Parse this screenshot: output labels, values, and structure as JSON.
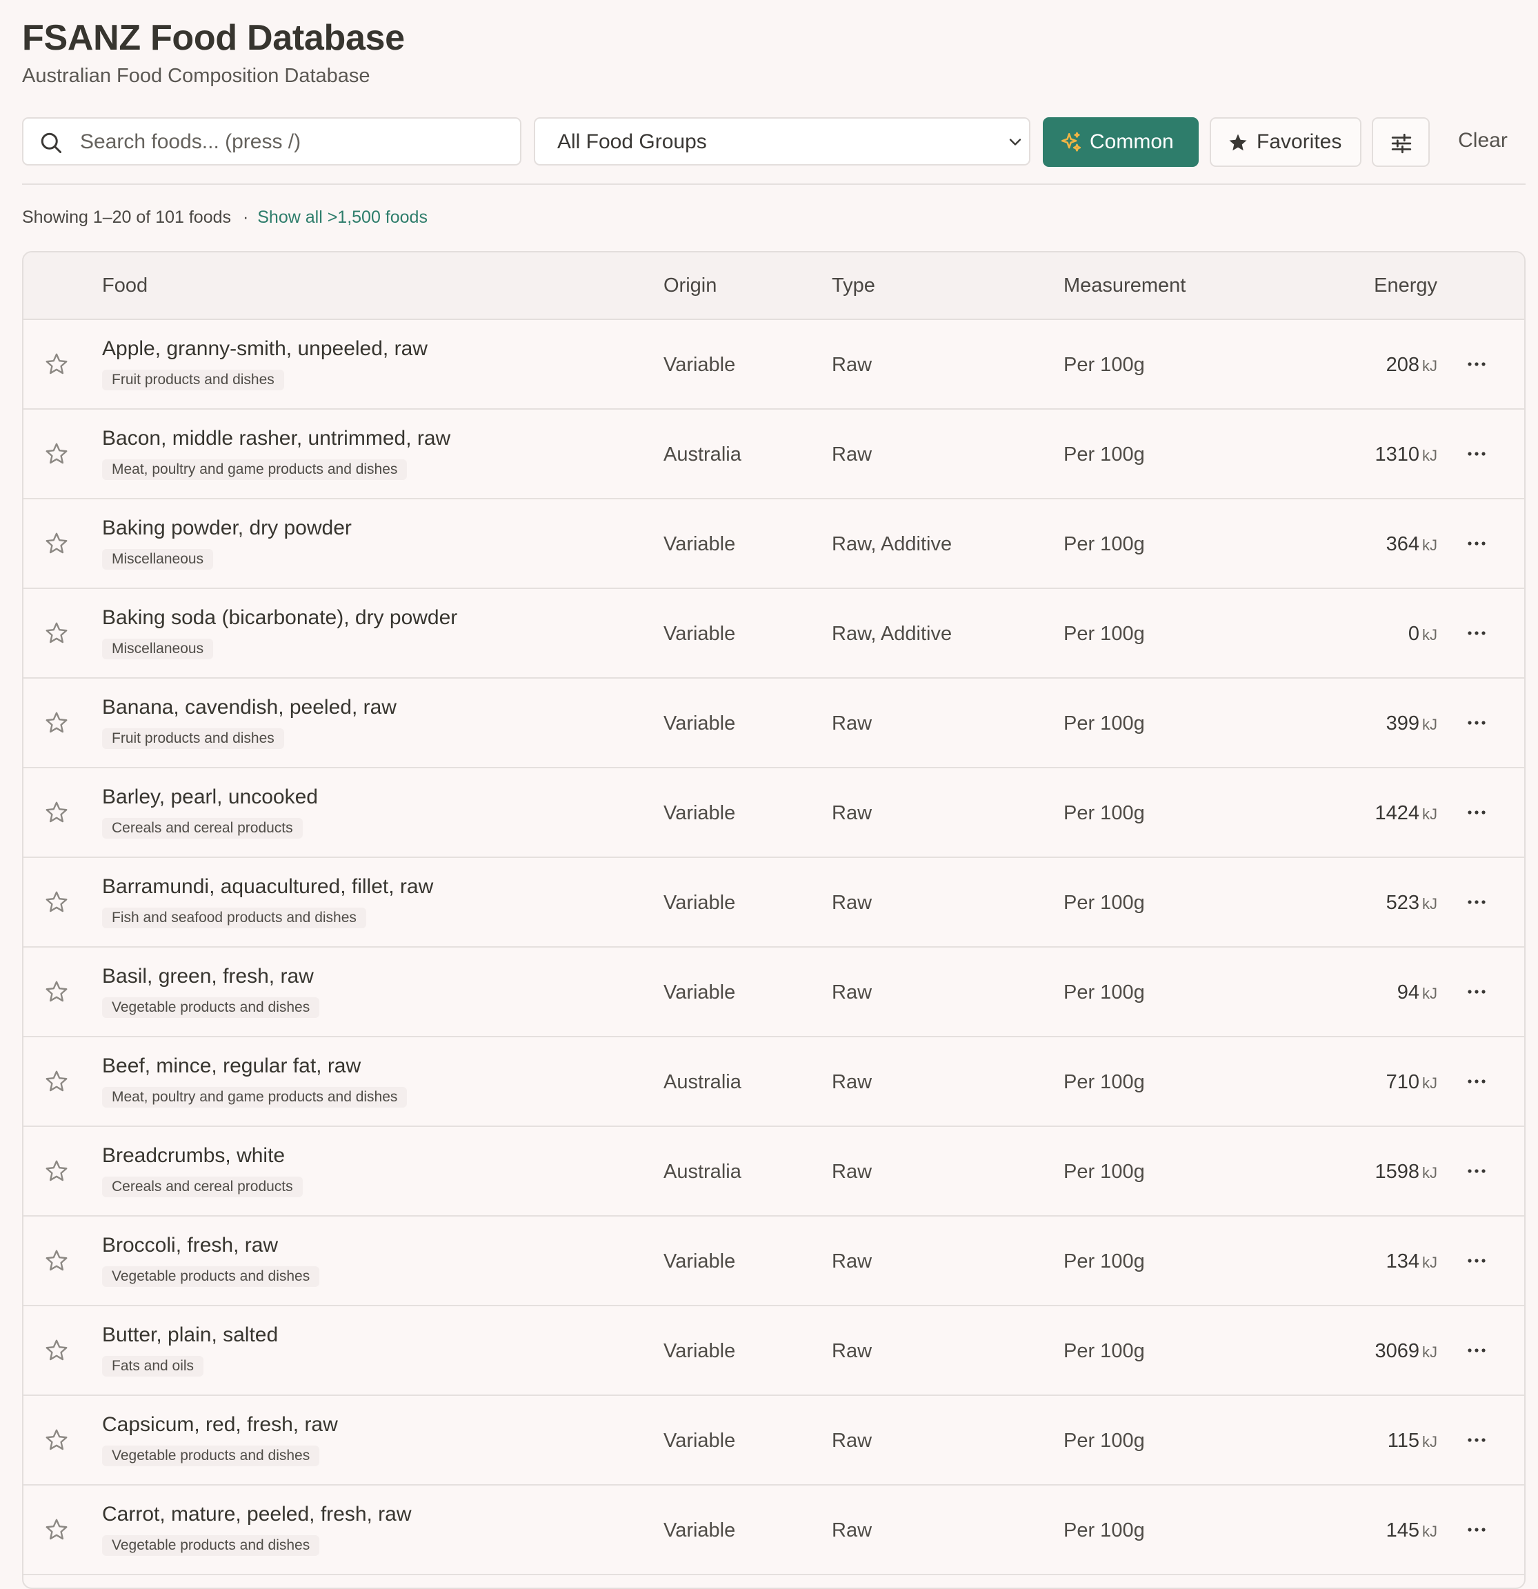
{
  "app": {
    "title": "FSANZ Food Database",
    "subtitle": "Australian Food Composition Database"
  },
  "toolbar": {
    "search_placeholder": "Search foods... (press /)",
    "search_value": "",
    "food_group_selected": "All Food Groups",
    "common_label": "Common",
    "favorites_label": "Favorites",
    "filter_icon": "sliders-icon",
    "clear_label": "Clear"
  },
  "summary": {
    "showing": "Showing 1–20 of 101 foods",
    "separator": "·",
    "show_all_link": "Show all >1,500 foods"
  },
  "colors": {
    "accent": "#2e7d6b",
    "background": "#fbf6f5",
    "sparkle": "#f2b544"
  },
  "table": {
    "headers": {
      "food": "Food",
      "origin": "Origin",
      "type": "Type",
      "measurement": "Measurement",
      "energy": "Energy"
    },
    "energy_unit": "kJ",
    "rows": [
      {
        "name": "Apple, granny-smith, unpeeled, raw",
        "group": "Fruit products and dishes",
        "origin": "Variable",
        "type": "Raw",
        "measurement": "Per 100g",
        "energy": "208"
      },
      {
        "name": "Bacon, middle rasher, untrimmed, raw",
        "group": "Meat, poultry and game products and dishes",
        "origin": "Australia",
        "type": "Raw",
        "measurement": "Per 100g",
        "energy": "1310"
      },
      {
        "name": "Baking powder, dry powder",
        "group": "Miscellaneous",
        "origin": "Variable",
        "type": "Raw, Additive",
        "measurement": "Per 100g",
        "energy": "364"
      },
      {
        "name": "Baking soda (bicarbonate), dry powder",
        "group": "Miscellaneous",
        "origin": "Variable",
        "type": "Raw, Additive",
        "measurement": "Per 100g",
        "energy": "0"
      },
      {
        "name": "Banana, cavendish, peeled, raw",
        "group": "Fruit products and dishes",
        "origin": "Variable",
        "type": "Raw",
        "measurement": "Per 100g",
        "energy": "399"
      },
      {
        "name": "Barley, pearl, uncooked",
        "group": "Cereals and cereal products",
        "origin": "Variable",
        "type": "Raw",
        "measurement": "Per 100g",
        "energy": "1424"
      },
      {
        "name": "Barramundi, aquacultured, fillet, raw",
        "group": "Fish and seafood products and dishes",
        "origin": "Variable",
        "type": "Raw",
        "measurement": "Per 100g",
        "energy": "523"
      },
      {
        "name": "Basil, green, fresh, raw",
        "group": "Vegetable products and dishes",
        "origin": "Variable",
        "type": "Raw",
        "measurement": "Per 100g",
        "energy": "94"
      },
      {
        "name": "Beef, mince, regular fat, raw",
        "group": "Meat, poultry and game products and dishes",
        "origin": "Australia",
        "type": "Raw",
        "measurement": "Per 100g",
        "energy": "710"
      },
      {
        "name": "Breadcrumbs, white",
        "group": "Cereals and cereal products",
        "origin": "Australia",
        "type": "Raw",
        "measurement": "Per 100g",
        "energy": "1598"
      },
      {
        "name": "Broccoli, fresh, raw",
        "group": "Vegetable products and dishes",
        "origin": "Variable",
        "type": "Raw",
        "measurement": "Per 100g",
        "energy": "134"
      },
      {
        "name": "Butter, plain, salted",
        "group": "Fats and oils",
        "origin": "Variable",
        "type": "Raw",
        "measurement": "Per 100g",
        "energy": "3069"
      },
      {
        "name": "Capsicum, red, fresh, raw",
        "group": "Vegetable products and dishes",
        "origin": "Variable",
        "type": "Raw",
        "measurement": "Per 100g",
        "energy": "115"
      },
      {
        "name": "Carrot, mature, peeled, fresh, raw",
        "group": "Vegetable products and dishes",
        "origin": "Variable",
        "type": "Raw",
        "measurement": "Per 100g",
        "energy": "145"
      }
    ]
  }
}
